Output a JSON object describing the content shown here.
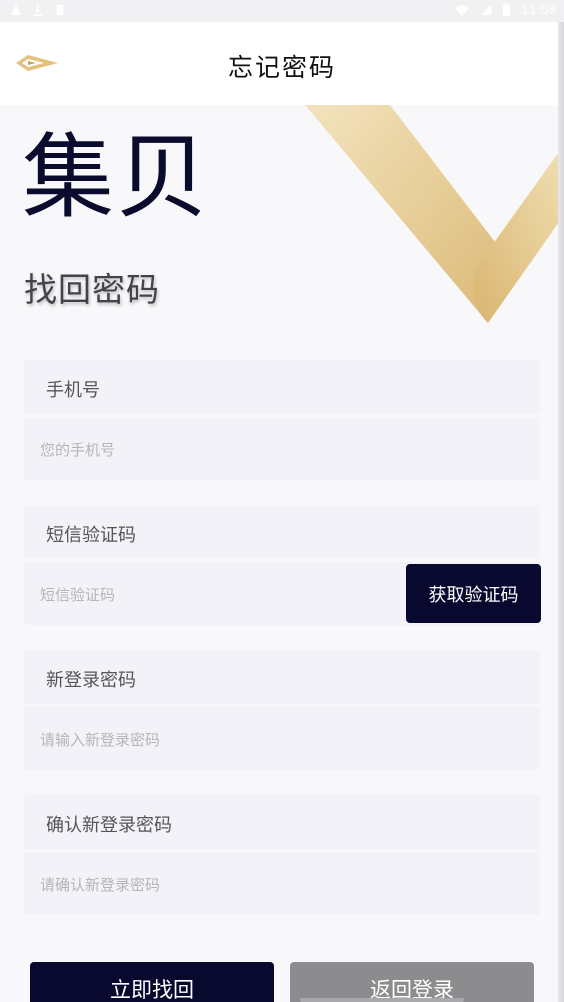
{
  "status_bar": {
    "time": "11:08",
    "icons": [
      "warning-icon",
      "download-icon",
      "sd-card-icon",
      "wifi-icon",
      "signal-icon",
      "battery-icon"
    ]
  },
  "header": {
    "title": "忘记密码",
    "logo": "brand-logo-icon"
  },
  "brand": {
    "name": "集贝",
    "subtitle": "找回密码"
  },
  "form": {
    "phone": {
      "label": "手机号",
      "placeholder": "您的手机号",
      "value": ""
    },
    "sms_code": {
      "label": "短信验证码",
      "placeholder": "短信验证码",
      "value": "",
      "button_label": "获取验证码"
    },
    "new_password": {
      "label": "新登录密码",
      "placeholder": "请输入新登录密码",
      "value": ""
    },
    "confirm_password": {
      "label": "确认新登录密码",
      "placeholder": "请确认新登录密码",
      "value": ""
    }
  },
  "actions": {
    "submit_label": "立即找回",
    "back_label": "返回登录"
  },
  "colors": {
    "primary": "#090930",
    "secondary": "#8c8c8e",
    "accent_gold": "#e2c27e",
    "field_bg": "#f3f2f8"
  }
}
